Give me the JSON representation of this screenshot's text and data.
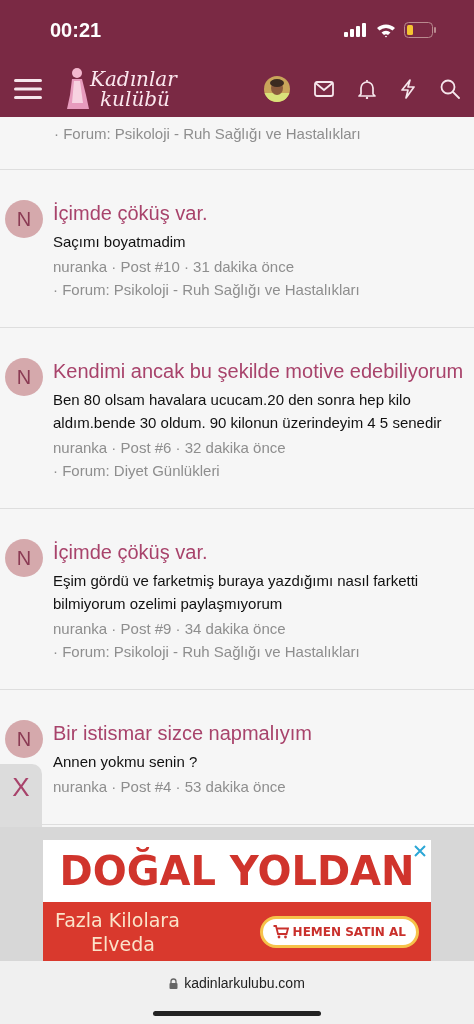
{
  "status_bar": {
    "time": "00:21"
  },
  "header": {
    "logo": [
      "Kadınlar",
      "kulübü"
    ]
  },
  "partial_row": {
    "forum": "· Forum: Psikoloji - Ruh Sağlığı ve Hastalıkları"
  },
  "posts": [
    {
      "avatar": "N",
      "title": "İçimde çöküş var.",
      "body": "Saçımı boyatmadim",
      "meta": "nuranka · Post #10 · 31 dakika önce",
      "forum": "· Forum: Psikoloji - Ruh Sağlığı ve Hastalıkları"
    },
    {
      "avatar": "N",
      "title": "Kendimi ancak bu şekilde motive edebiliyorum",
      "body": "Ben 80 olsam havalara ucucam.20 den sonra hep kilo aldım.bende 30 oldum. 90 kilonun üzerindeyim 4 5 senedir",
      "meta": "nuranka · Post #6 · 32 dakika önce",
      "forum": "· Forum: Diyet Günlükleri"
    },
    {
      "avatar": "N",
      "title": "İçimde çöküş var.",
      "body": "Eşim gördü ve farketmiş buraya yazdığımı nasıl farketti bilmiyorum ozelimi paylaşmıyorum",
      "meta": "nuranka · Post #9 · 34 dakika önce",
      "forum": "· Forum: Psikoloji - Ruh Sağlığı ve Hastalıkları"
    },
    {
      "avatar": "N",
      "title": "Bir istismar sizce napmalıyım",
      "body": "Annen yokmu senin ?",
      "meta": "nuranka · Post #4 · 53 dakika önce"
    }
  ],
  "ad_tab": {
    "label": "X"
  },
  "ad": {
    "headline": "DOĞAL YOLDAN",
    "subline": [
      "Fazla Kilolara",
      "Elveda"
    ],
    "button": "HEMEN SATIN AL"
  },
  "address_bar": {
    "url": "kadinlarkulubu.com"
  }
}
